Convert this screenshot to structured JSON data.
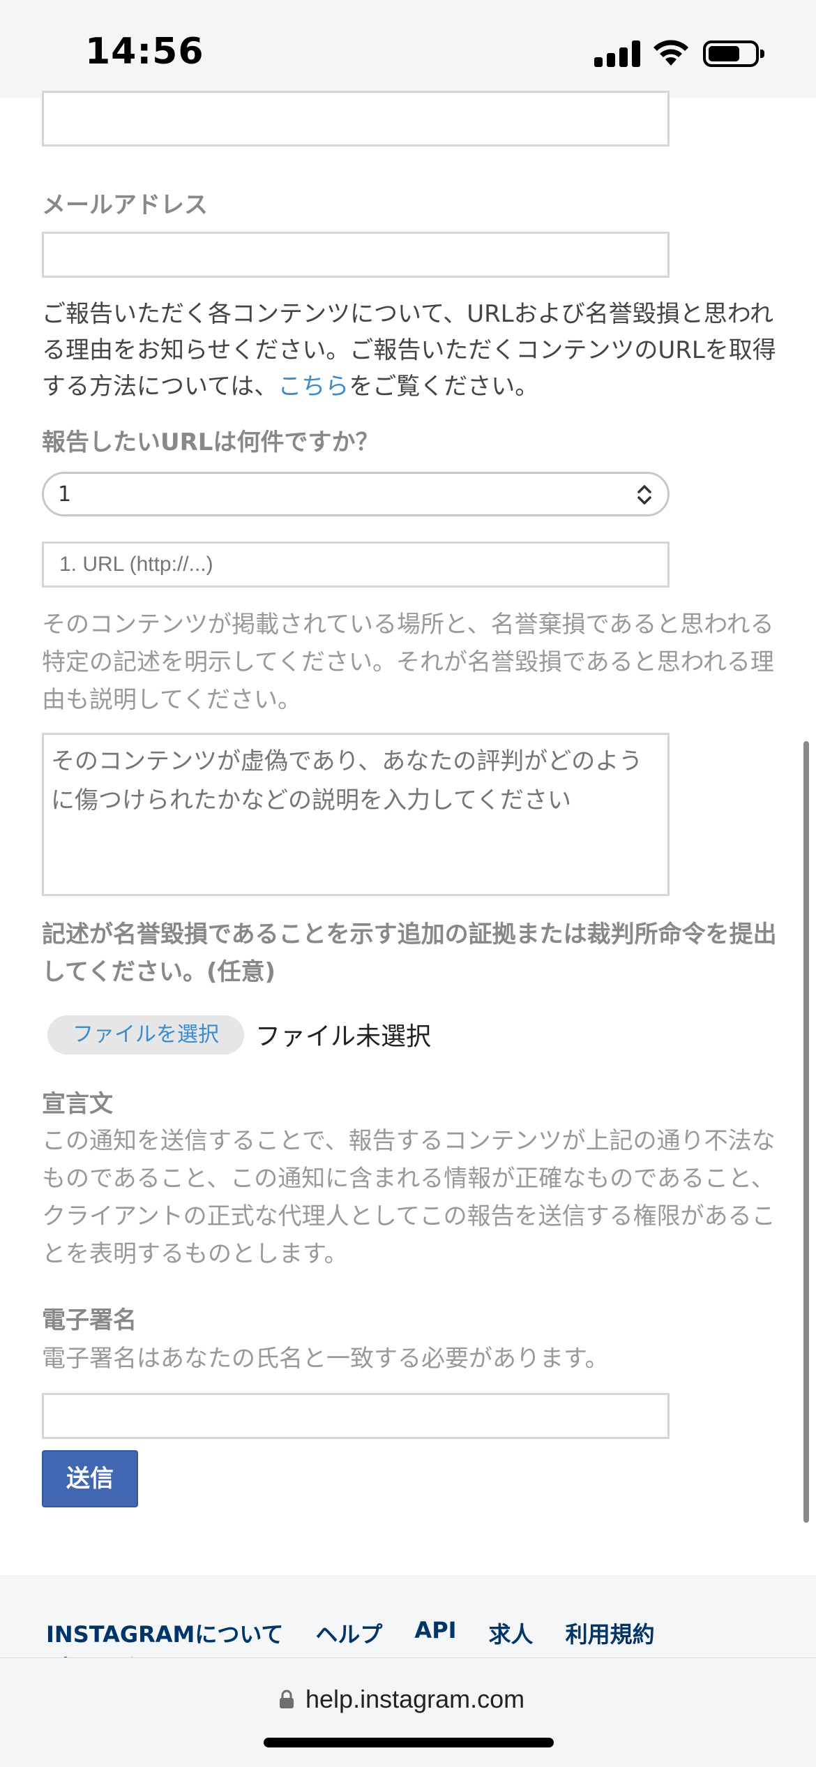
{
  "status_bar": {
    "time": "14:56"
  },
  "form": {
    "email_label": "メールアドレス",
    "instructions": {
      "before_link": "ご報告いただく各コンテンツについて、URLおよび名誉毀損と思われる理由をお知らせください。ご報告いただくコンテンツのURLを取得する方法については、",
      "link": "こちら",
      "after_link": "をご覧ください。"
    },
    "url_count_label": "報告したいURLは何件ですか？",
    "url_count_value": "1",
    "url_placeholder": "1. URL (http://...)",
    "description_help": "そのコンテンツが掲載されている場所と、名誉棄損であると思われる特定の記述を明示してください。それが名誉毀損であると思われる理由も説明してください。",
    "description_placeholder": "そのコンテンツが虚偽であり、あなたの評判がどのように傷つけられたかなどの説明を入力してください",
    "evidence_label": "記述が名誉毀損であることを示す追加の証拠または裁判所命令を提出してください。(任意)",
    "file_button": "ファイルを選択",
    "file_status": "ファイル未選択",
    "declaration_title": "宣言文",
    "declaration_text": "この通知を送信することで、報告するコンテンツが上記の通り不法なものであること、この通知に含まれる情報が正確なものであること、クライアントの正式な代理人としてこの報告を送信する権限があることを表明するものとします。",
    "signature_label": "電子署名",
    "signature_help": "電子署名はあなたの氏名と一致する必要があります。",
    "submit": "送信"
  },
  "footer": {
    "links": [
      "INSTAGRAMについて",
      "ヘルプ",
      "API",
      "求人",
      "利用規約"
    ],
    "cut_link": "プライバシー"
  },
  "browser": {
    "url": "help.instagram.com"
  },
  "colors": {
    "link": "#3b8bd0",
    "submit": "#4267b2",
    "footer_link": "#003569"
  }
}
